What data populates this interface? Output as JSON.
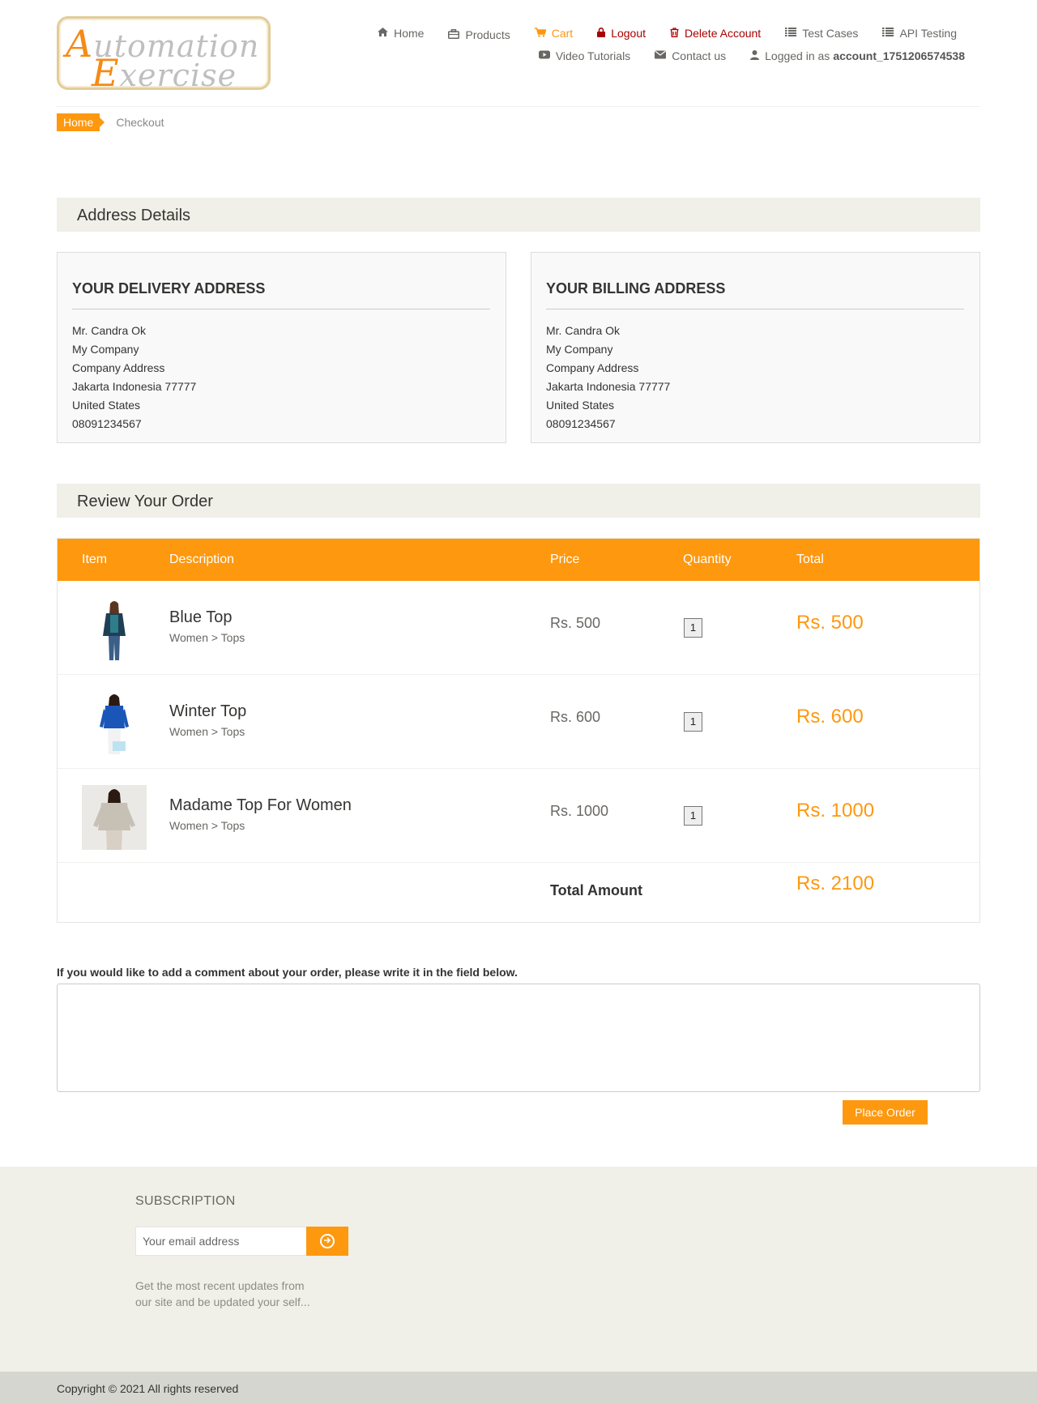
{
  "logo": {
    "cap1": "A",
    "rest1": "utomation",
    "cap2": "E",
    "rest2": "xercise"
  },
  "nav": {
    "home": "Home",
    "products": "Products",
    "cart": "Cart",
    "logout": "Logout",
    "delete_account": "Delete Account",
    "test_cases": "Test Cases",
    "api_testing": "API Testing",
    "video_tutorials": "Video Tutorials",
    "contact_us": "Contact us",
    "logged_in_prefix": "Logged in as",
    "username": "account_1751206574538"
  },
  "breadcrumb": {
    "home": "Home",
    "current": "Checkout"
  },
  "address_section": {
    "title": "Address Details",
    "delivery": {
      "heading": "YOUR DELIVERY ADDRESS",
      "name": "Mr. Candra Ok",
      "company": "My Company",
      "address": "Company Address",
      "city": "Jakarta Indonesia 77777",
      "country": "United States",
      "phone": "08091234567"
    },
    "billing": {
      "heading": "YOUR BILLING ADDRESS",
      "name": "Mr. Candra Ok",
      "company": "My Company",
      "address": "Company Address",
      "city": "Jakarta Indonesia 77777",
      "country": "United States",
      "phone": "08091234567"
    }
  },
  "review_section": {
    "title": "Review Your Order",
    "headers": {
      "item": "Item",
      "description": "Description",
      "price": "Price",
      "quantity": "Quantity",
      "total": "Total"
    },
    "items": [
      {
        "name": "Blue Top",
        "category": "Women > Tops",
        "price": "Rs. 500",
        "quantity": "1",
        "total": "Rs. 500"
      },
      {
        "name": "Winter Top",
        "category": "Women > Tops",
        "price": "Rs. 600",
        "quantity": "1",
        "total": "Rs. 600"
      },
      {
        "name": "Madame Top For Women",
        "category": "Women > Tops",
        "price": "Rs. 1000",
        "quantity": "1",
        "total": "Rs. 1000"
      }
    ],
    "total_label": "Total Amount",
    "total_value": "Rs. 2100"
  },
  "comment": {
    "label": "If you would like to add a comment about your order, please write it in the field below.",
    "value": ""
  },
  "place_order": "Place Order",
  "footer": {
    "subscription_title": "SUBSCRIPTION",
    "email_placeholder": "Your email address",
    "description": "Get the most recent updates from our site and be updated your self...",
    "copyright": "Copyright © 2021 All rights reserved"
  },
  "colors": {
    "accent": "#fe980f",
    "danger": "#aa0000",
    "section_bg": "#f0f0e9"
  },
  "icons": [
    "home-icon",
    "briefcase-icon",
    "cart-icon",
    "lock-icon",
    "trash-icon",
    "list-icon",
    "youtube-icon",
    "envelope-icon",
    "user-icon",
    "arrow-circle-right-icon"
  ]
}
